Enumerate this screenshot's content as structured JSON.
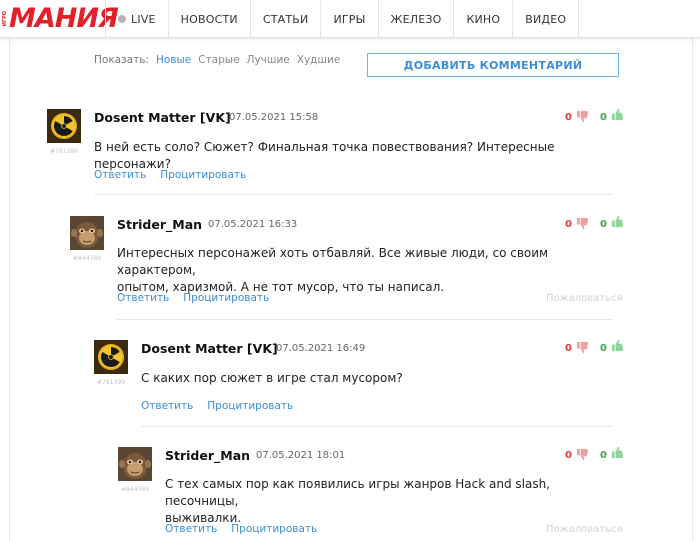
{
  "header": {
    "logo_prefix": "ИГРО",
    "logo": "МАНИЯ",
    "nav": [
      "LIVE",
      "НОВОСТИ",
      "СТАТЬИ",
      "ИГРЫ",
      "ЖЕЛЕЗО",
      "КИНО",
      "ВИДЕО"
    ]
  },
  "sort": {
    "label": "Показать:",
    "options": [
      "Новые",
      "Старые",
      "Лучшие",
      "Худшие"
    ],
    "active": "Новые"
  },
  "add_comment_label": "ДОБАВИТЬ КОММЕНТАРИЙ",
  "comments": [
    {
      "author": "Dosent Matter [VK]",
      "user_id": "#791399",
      "date": "07.05.2021 15:58",
      "text": "В ней есть соло? Сюжет? Финальная точка повествования? Интересные персонажи?",
      "down": "0",
      "up": "0",
      "reply_label": "Ответить",
      "quote_label": "Процитировать",
      "report_label": "",
      "avatar_icon": "radiation-icon"
    },
    {
      "author": "Strider_Man",
      "user_id": "#844369",
      "date": "07.05.2021 16:33",
      "text_lines": [
        "Интересных персонажей хоть отбавляй. Все живые люди, со своим характером,",
        "опытом, харизмой. А не тот мусор, что ты написал."
      ],
      "down": "0",
      "up": "0",
      "reply_label": "Ответить",
      "quote_label": "Процитировать",
      "report_label": "Пожаловаться",
      "avatar_icon": "monkey-icon"
    },
    {
      "author": "Dosent Matter [VK]",
      "user_id": "#791399",
      "date": "07.05.2021 16:49",
      "text": "С каких пор сюжет в игре стал мусором?",
      "down": "0",
      "up": "0",
      "reply_label": "Ответить",
      "quote_label": "Процитировать",
      "report_label": "",
      "avatar_icon": "radiation-icon"
    },
    {
      "author": "Strider_Man",
      "user_id": "#844369",
      "date": "07.05.2021 18:01",
      "text_lines": [
        "С тех самых пор как появились игры жанров Hack and slash, песочницы,",
        "выживалки."
      ],
      "down": "0",
      "up": "0",
      "reply_label": "Ответить",
      "quote_label": "Процитировать",
      "report_label": "Пожаловаться",
      "avatar_icon": "monkey-icon"
    }
  ],
  "colors": {
    "brand": "#e3202a",
    "link": "#3a8fd8",
    "downvote": "#e03a3a",
    "upvote": "#3aa84a"
  }
}
